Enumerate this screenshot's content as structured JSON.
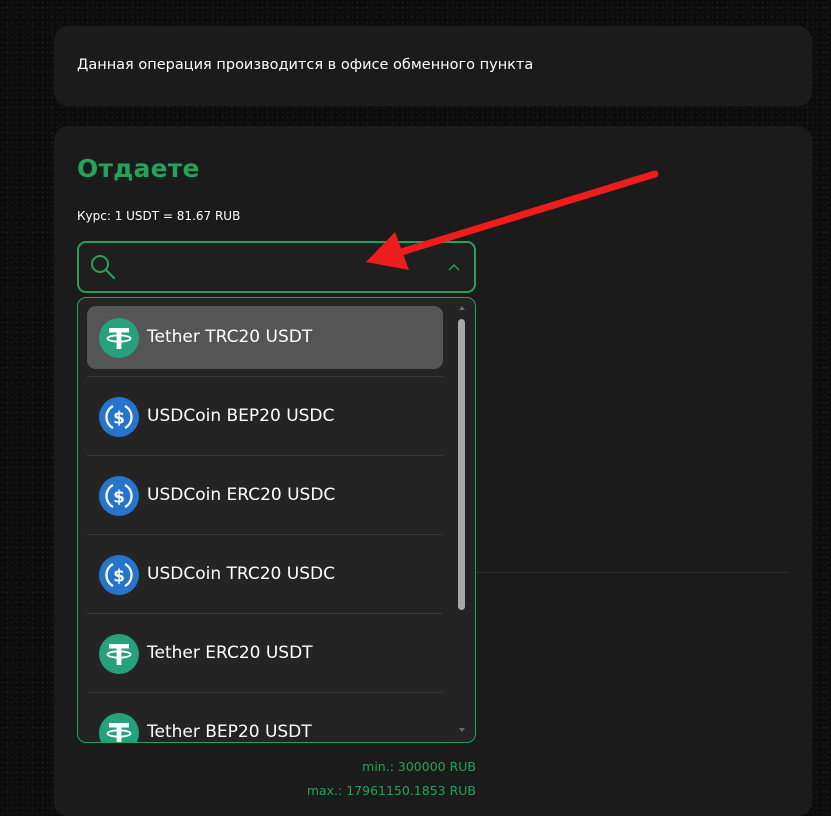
{
  "notice": {
    "text": "Данная операция производится в офисе обменного пункта"
  },
  "give": {
    "title": "Отдаете",
    "rate": "Курс: 1 USDT = 81.67 RUB",
    "search": {
      "value": "",
      "placeholder": ""
    },
    "options": [
      {
        "label": "Tether TRC20 USDT",
        "icon": "tether-icon",
        "selected": true
      },
      {
        "label": "USDCoin BEP20 USDC",
        "icon": "usdc-icon",
        "selected": false
      },
      {
        "label": "USDCoin ERC20 USDC",
        "icon": "usdc-icon",
        "selected": false
      },
      {
        "label": "USDCoin TRC20 USDC",
        "icon": "usdc-icon",
        "selected": false
      },
      {
        "label": "Tether ERC20 USDT",
        "icon": "tether-icon",
        "selected": false
      },
      {
        "label": "Tether BEP20 USDT",
        "icon": "tether-icon",
        "selected": false
      }
    ],
    "min": "min.: 300000 RUB",
    "max": "max.: 17961150.1853 RUB"
  },
  "colors": {
    "accent": "#27a15a",
    "tether": "#26a17b",
    "usdc": "#2775ca",
    "annotation_arrow": "#ee1c1c"
  }
}
